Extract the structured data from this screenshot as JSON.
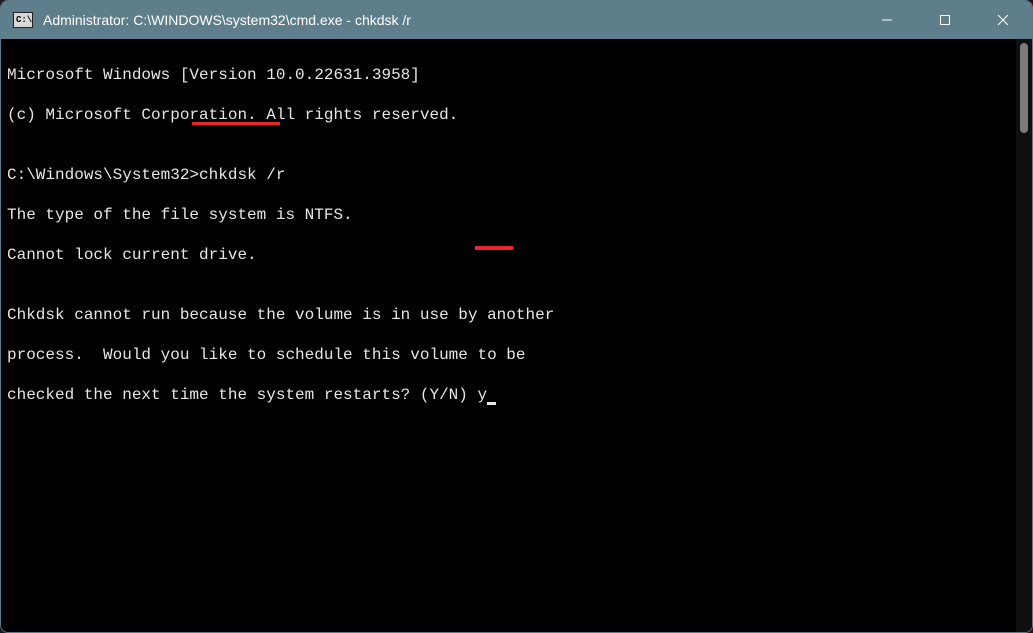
{
  "titlebar": {
    "icon_label": "C:\\",
    "title": "Administrator: C:\\WINDOWS\\system32\\cmd.exe - chkdsk  /r"
  },
  "terminal": {
    "line1": "Microsoft Windows [Version 10.0.22631.3958]",
    "line2": "(c) Microsoft Corporation. All rights reserved.",
    "blank1": "",
    "prompt_prefix": "C:\\Windows\\System32>",
    "prompt_command": "chkdsk /r",
    "line4": "The type of the file system is NTFS.",
    "line5": "Cannot lock current drive.",
    "blank2": "",
    "line6": "Chkdsk cannot run because the volume is in use by another",
    "line7": "process.  Would you like to schedule this volume to be",
    "line8a": "checked the next time the system restarts? (Y/N) ",
    "input_char": "y"
  }
}
